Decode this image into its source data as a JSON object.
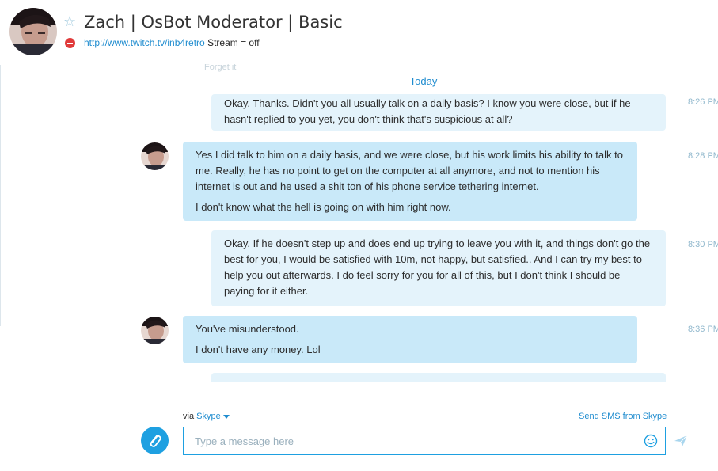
{
  "header": {
    "contact_name": "Zach | OsBot Moderator | Basic",
    "mood_link": "http://www.twitch.tv/inb4retro",
    "mood_text": "Stream = off",
    "favorite_icon": "star-outline-icon",
    "status_icon": "do-not-disturb-icon",
    "status": "Do not disturb"
  },
  "chat": {
    "faded_text": "Forget it",
    "day_separator": "Today",
    "messages": [
      {
        "direction": "outgoing",
        "time": "8:26 PM",
        "paragraphs": [
          "Okay. Thanks. Didn't you all usually talk on a daily basis? I know you were close, but if he hasn't replied to you yet, you don't think that's suspicious at all?"
        ]
      },
      {
        "direction": "incoming",
        "time": "8:28 PM",
        "paragraphs": [
          "Yes I did talk to him on a daily basis, and we were close, but his work limits his ability to talk to me. Really, he has no point to get on the computer at all anymore, and not to mention his internet is out and he used a shit ton of his phone service tethering internet.",
          "I don't know what the hell is going on with him right now."
        ]
      },
      {
        "direction": "outgoing",
        "time": "8:30 PM",
        "paragraphs": [
          "Okay. If he doesn't step up and does end up trying to leave you with it, and things don't go the best for you, I would be satisfied with 10m, not happy, but satisfied.. And I can try my best to help you out afterwards. I do feel sorry for you for all of this, but I don't think I should be paying for it either."
        ]
      },
      {
        "direction": "incoming",
        "time": "8:36 PM",
        "paragraphs": [
          "You've misunderstood.",
          "I don't have any money. Lol"
        ]
      }
    ]
  },
  "footer": {
    "via_label": "via",
    "via_service": "Skype",
    "send_sms_label": "Send SMS from Skype",
    "input_placeholder": "Type a message here",
    "attach_icon": "paperclip-icon",
    "emoji_icon": "smiley-icon",
    "send_icon": "send-icon"
  },
  "colors": {
    "accent": "#1ea0e1",
    "outgoing_bubble": "#e4f3fb",
    "incoming_bubble": "#c9e9f9",
    "status_dnd": "#e03a3a"
  }
}
